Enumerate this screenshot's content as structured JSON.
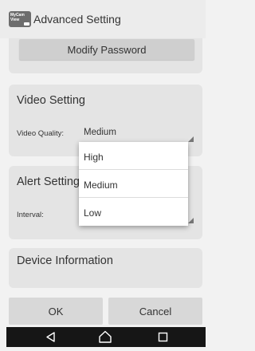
{
  "app": {
    "icon_text_line1": "MyCam",
    "icon_text_line2": "View",
    "title": "Advanced Setting"
  },
  "account": {
    "modify_password_label": "Modify Password"
  },
  "video": {
    "title": "Video Setting",
    "quality_label": "Video Quality:",
    "quality_value": "Medium"
  },
  "dropdown": {
    "options": [
      "High",
      "Medium",
      "Low"
    ]
  },
  "alert": {
    "title": "Alert Setting",
    "interval_label": "Interval:"
  },
  "device": {
    "title": "Device Information"
  },
  "actions": {
    "ok_label": "OK",
    "cancel_label": "Cancel"
  },
  "navbar": {
    "icons": [
      "back-icon",
      "home-icon",
      "recents-icon"
    ]
  },
  "colors": {
    "background": "#f2f2f2",
    "card": "#e4e4e4",
    "button": "#d8d8d8",
    "navbar": "#161616"
  }
}
